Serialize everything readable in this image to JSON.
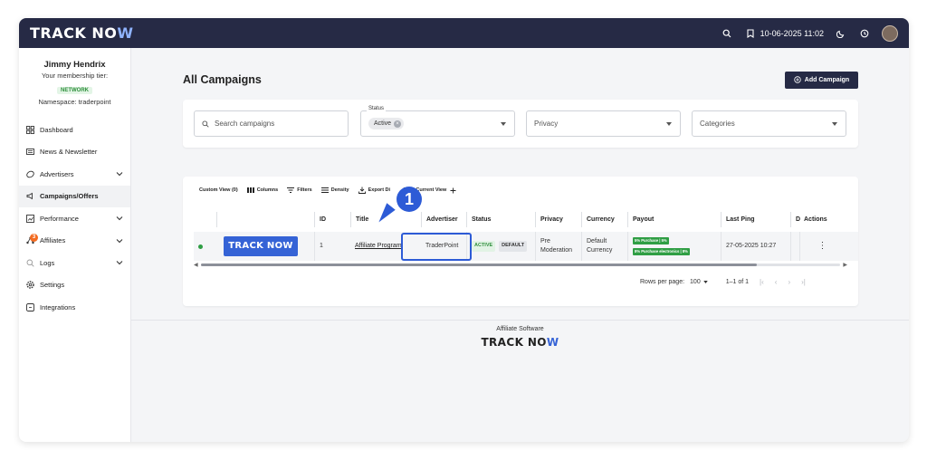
{
  "app": {
    "logo_main": "TRACK NO",
    "logo_accent": "W",
    "topbar": {
      "datetime": "10-06-2025 11:02"
    }
  },
  "sidebar": {
    "user_name": "Jimmy Hendrix",
    "tier_label": "Your membership tier:",
    "tier": "NETWORK",
    "namespace": "Namespace: traderpoint",
    "items": [
      {
        "label": "Dashboard",
        "icon": "dashboard-icon"
      },
      {
        "label": "News & Newsletter",
        "icon": "news-icon"
      },
      {
        "label": "Advertisers",
        "icon": "advertisers-icon"
      },
      {
        "label": "Campaigns/Offers",
        "icon": "campaigns-icon"
      },
      {
        "label": "Performance",
        "icon": "performance-icon"
      },
      {
        "label": "Affiliates",
        "icon": "affiliates-icon",
        "badge": "3"
      },
      {
        "label": "Logs",
        "icon": "logs-icon"
      },
      {
        "label": "Settings",
        "icon": "settings-icon"
      },
      {
        "label": "Integrations",
        "icon": "integrations-icon"
      }
    ]
  },
  "main": {
    "title": "All Campaigns",
    "add_button": "Add Campaign",
    "filters": {
      "search_placeholder": "Search campaigns",
      "status_label": "Status",
      "status_chip": "Active",
      "privacy": "Privacy",
      "categories": "Categories"
    },
    "toolbar": {
      "custom_view": "Custom View (0)",
      "columns": "Columns",
      "filters": "Filters",
      "density": "Density",
      "export": "Export Di",
      "save_view": "Save Current View"
    },
    "table": {
      "headers": [
        "ID",
        "Title",
        "Advertiser",
        "Status",
        "Privacy",
        "Currency",
        "Payout",
        "Last Ping",
        "D",
        "Actions"
      ],
      "row": {
        "logo": "TRACK NOW",
        "id": "1",
        "title": "Affiliate Program",
        "advertiser": "TraderPoint",
        "status_active": "ACTIVE",
        "status_default": "DEFAULT",
        "privacy_line1": "Pre",
        "privacy_line2": "Moderation",
        "currency_line1": "Default",
        "currency_line2": "Currency",
        "payout_1": "5% Purchase | 5%",
        "payout_2": "8% Purchase electronics | 8%",
        "last_ping": "27-05-2025 10:27"
      }
    },
    "pagination": {
      "rows_label": "Rows per page:",
      "rows_value": "100",
      "range": "1–1 of 1"
    },
    "callout_number": "1"
  },
  "footer": {
    "text": "Affiliate Software",
    "logo_main": "TRACK NO",
    "logo_accent": "W"
  }
}
